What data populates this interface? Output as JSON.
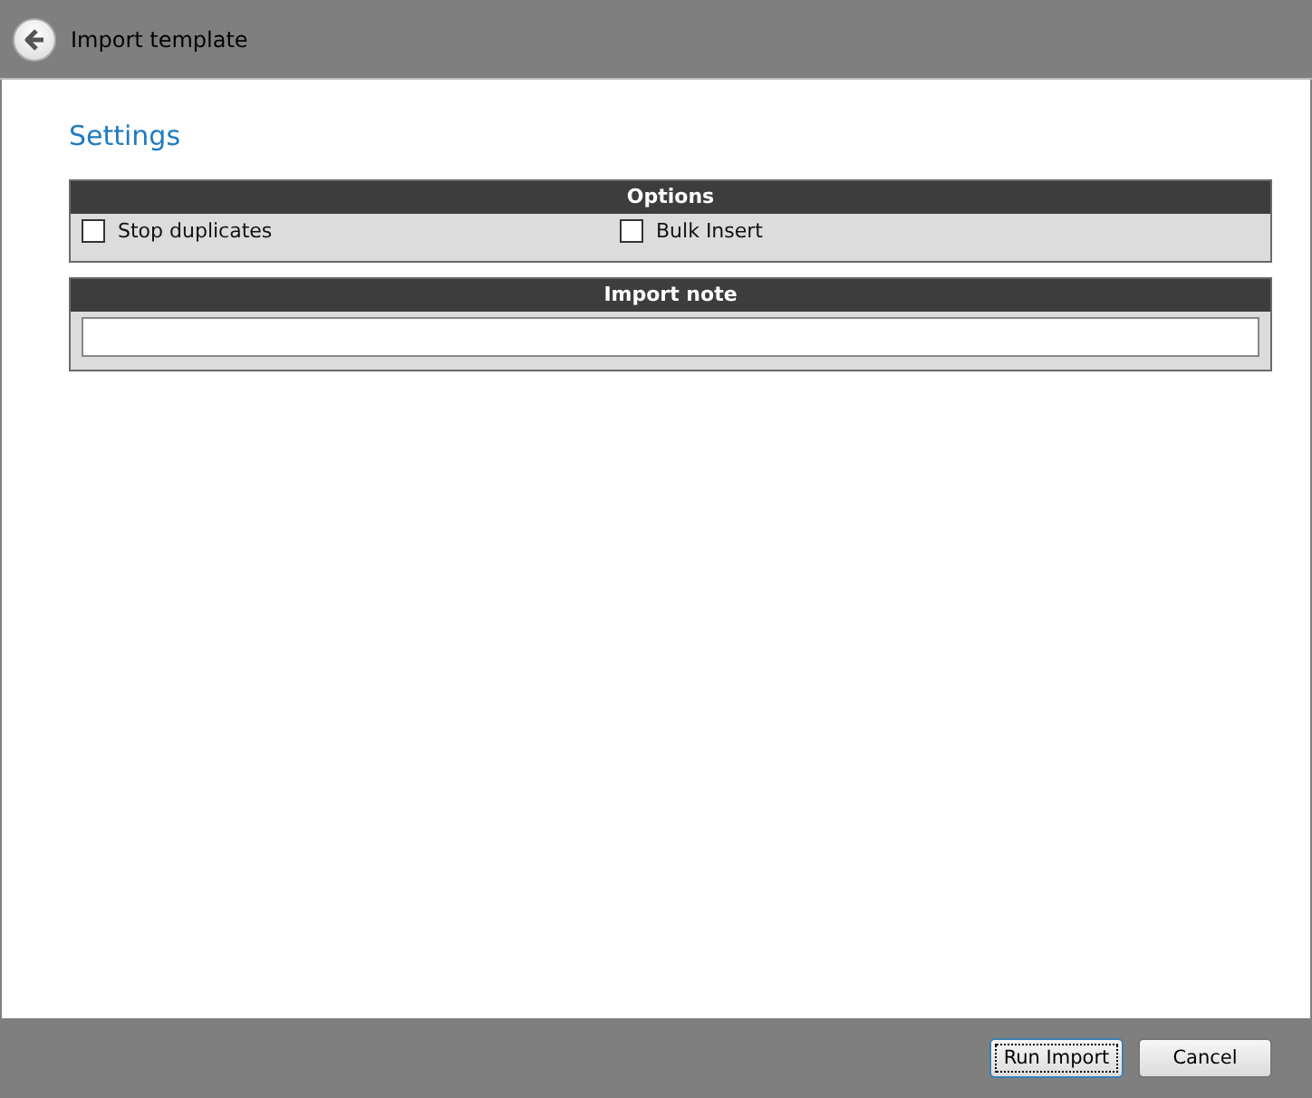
{
  "window": {
    "title": "Import template"
  },
  "heading": "Settings",
  "options_panel": {
    "title": "Options",
    "checkboxes": [
      {
        "label": "Stop duplicates",
        "checked": false
      },
      {
        "label": "Bulk Insert",
        "checked": false
      }
    ]
  },
  "note_panel": {
    "title": "Import note"
  },
  "buttons": [
    {
      "label": "Run Import",
      "focused": true
    },
    {
      "label": "Cancel",
      "focused": false
    }
  ]
}
